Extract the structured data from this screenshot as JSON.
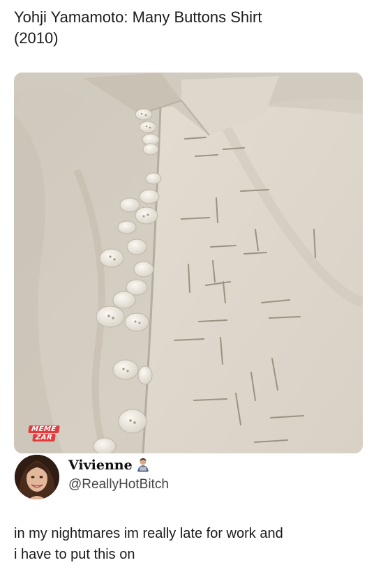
{
  "post": {
    "caption_line1": "Yohji Yamamoto: Many Buttons Shirt",
    "caption_line2": "(2010)"
  },
  "photo": {
    "subject": "shirt-photo",
    "watermark_line1": "MEME",
    "watermark_line2": "ZAR"
  },
  "tweet": {
    "display_name": "Vivienne",
    "badge_icon": "person-laptop-icon",
    "handle": "@ReallyHotBitch",
    "text_line1": "in my nightmares im really late for work and",
    "text_line2": "i have to put this on"
  },
  "colors": {
    "shirt": "#d9d3c8",
    "button": "#f1ede4",
    "watermark": "#e23b3b"
  }
}
